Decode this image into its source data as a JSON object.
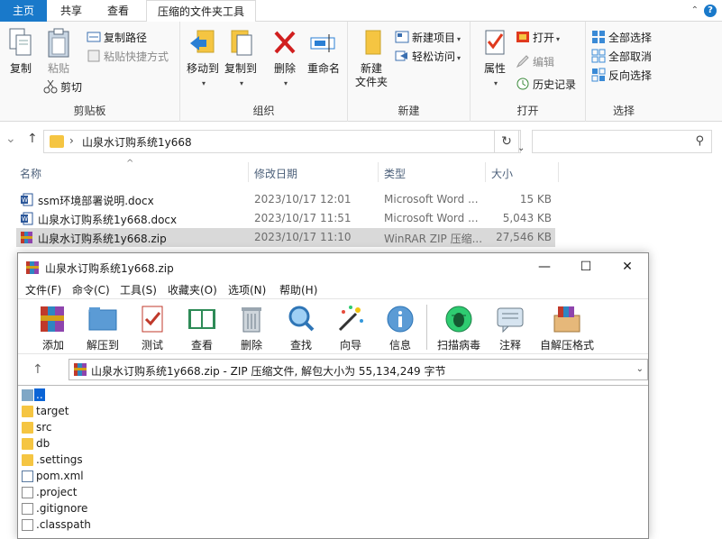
{
  "ribbon_tabs": {
    "home": "主页",
    "share": "共享",
    "view": "查看",
    "compressed": "压缩的文件夹工具"
  },
  "ribbon": {
    "clipboard": {
      "label": "剪贴板",
      "copy": "复制",
      "paste": "粘贴",
      "copy_path": "复制路径",
      "paste_shortcut": "粘贴快捷方式",
      "cut": "剪切"
    },
    "organize": {
      "label": "组织",
      "move_to": "移动到",
      "copy_to": "复制到",
      "delete": "删除",
      "rename": "重命名"
    },
    "new": {
      "label": "新建",
      "new_folder": "新建\n文件夹",
      "new_item": "新建项目",
      "easy_access": "轻松访问"
    },
    "open": {
      "label": "打开",
      "properties": "属性",
      "open": "打开",
      "edit": "编辑",
      "history": "历史记录"
    },
    "select": {
      "label": "选择",
      "select_all": "全部选择",
      "select_none": "全部取消",
      "invert": "反向选择"
    }
  },
  "address": {
    "path": "山泉水订购系统1y668",
    "separator": "›"
  },
  "columns": {
    "name": "名称",
    "date": "修改日期",
    "type": "类型",
    "size": "大小"
  },
  "files": [
    {
      "name": "ssm环境部署说明.docx",
      "date": "2023/10/17 12:01",
      "type": "Microsoft Word ...",
      "size": "15 KB",
      "icon": "word-icon"
    },
    {
      "name": "山泉水订购系统1y668.docx",
      "date": "2023/10/17 11:51",
      "type": "Microsoft Word ...",
      "size": "5,043 KB",
      "icon": "word-icon"
    },
    {
      "name": "山泉水订购系统1y668.zip",
      "date": "2023/10/17 11:10",
      "type": "WinRAR ZIP 压缩...",
      "size": "27,546 KB",
      "icon": "winrar-icon"
    }
  ],
  "rar": {
    "title": "山泉水订购系统1y668.zip",
    "menu": [
      "文件(F)",
      "命令(C)",
      "工具(S)",
      "收藏夹(O)",
      "选项(N)",
      "帮助(H)"
    ],
    "toolbar": [
      "添加",
      "解压到",
      "测试",
      "查看",
      "删除",
      "查找",
      "向导",
      "信息",
      "扫描病毒",
      "注释",
      "自解压格式"
    ],
    "path_text": "山泉水订购系统1y668.zip - ZIP 压缩文件, 解包大小为 55,134,249 字节",
    "items": [
      {
        "name": "..",
        "kind": "up"
      },
      {
        "name": "target",
        "kind": "folder"
      },
      {
        "name": "src",
        "kind": "folder"
      },
      {
        "name": "db",
        "kind": "folder"
      },
      {
        "name": ".settings",
        "kind": "folder"
      },
      {
        "name": "pom.xml",
        "kind": "xml"
      },
      {
        "name": ".project",
        "kind": "file"
      },
      {
        "name": ".gitignore",
        "kind": "file"
      },
      {
        "name": ".classpath",
        "kind": "file"
      }
    ]
  }
}
